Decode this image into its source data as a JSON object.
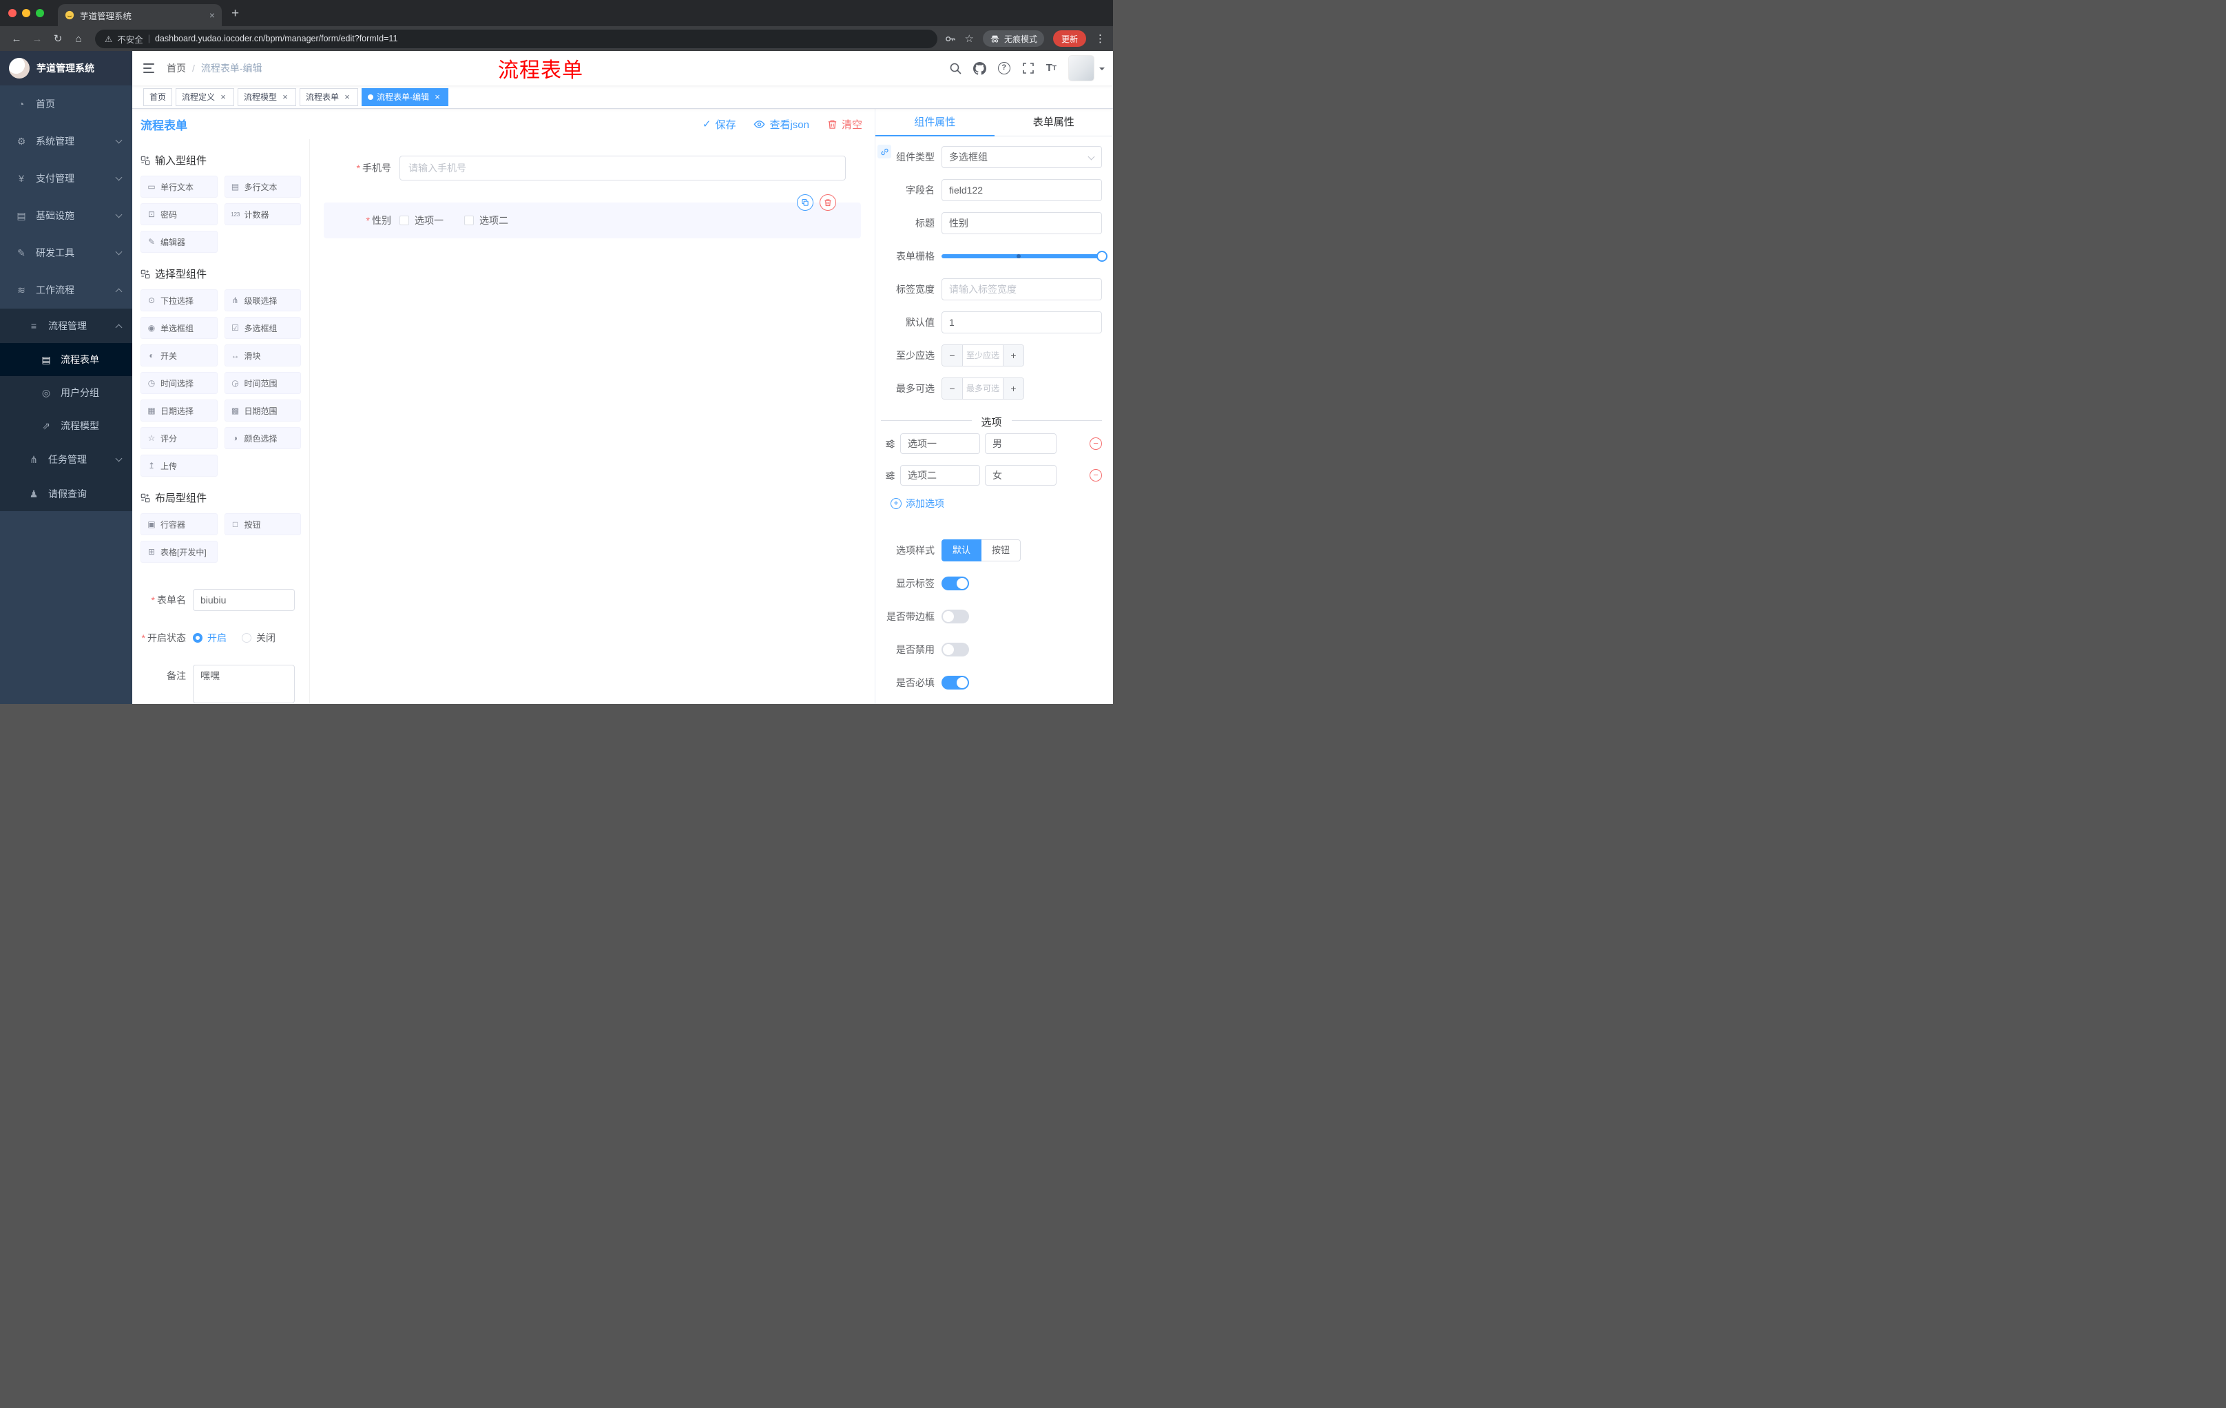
{
  "ui": {
    "close": "×",
    "plus": "+",
    "minus": "−",
    "check": "✓",
    "question": "?",
    "kebab": "⋮",
    "star": "☆",
    "asterisk": "*",
    "t_big": "T",
    "t_small": "T"
  },
  "colors": {
    "accent": "#409eff",
    "danger": "#f56c6c",
    "sidebar": "#304156",
    "active_item": "#001528",
    "overlay_red": "#fe0000"
  },
  "browser": {
    "tab_title": "芋道管理系统",
    "nav_back": "←",
    "nav_forward": "→",
    "nav_reload": "↻",
    "nav_home": "⌂",
    "omnibox_warning": "⚠",
    "omnibox_security": "不安全",
    "omnibox_divider": "|",
    "url": "dashboard.yudao.iocoder.cn/bpm/manager/form/edit?formId=11",
    "incognito_label": "无痕模式",
    "update_label": "更新"
  },
  "sidebar": {
    "logo_title": "芋道管理系统",
    "menu": [
      {
        "glyph": "◔",
        "label": "首页"
      },
      {
        "glyph": "⚙",
        "label": "系统管理"
      },
      {
        "glyph": "¥",
        "label": "支付管理"
      },
      {
        "glyph": "▤",
        "label": "基础设施"
      },
      {
        "glyph": "✎",
        "label": "研发工具"
      },
      {
        "glyph": "≋",
        "label": "工作流程"
      }
    ],
    "process_group": {
      "glyph": "≡",
      "label": "流程管理"
    },
    "process_children": [
      {
        "glyph": "▤",
        "label": "流程表单",
        "active": true
      },
      {
        "glyph": "◎",
        "label": "用户分组",
        "active": false
      },
      {
        "glyph": "⇗",
        "label": "流程模型",
        "active": false
      }
    ],
    "task_item": {
      "glyph": "⋔",
      "label": "任务管理"
    },
    "leave_item": {
      "glyph": "♟",
      "label": "请假查询"
    }
  },
  "header": {
    "breadcrumb_home": "首页",
    "breadcrumb_sep": "/",
    "breadcrumb_current": "流程表单-编辑",
    "overlay_title": "流程表单"
  },
  "tags": [
    {
      "label": "首页",
      "closable": false,
      "active": false
    },
    {
      "label": "流程定义",
      "closable": true,
      "active": false
    },
    {
      "label": "流程模型",
      "closable": true,
      "active": false
    },
    {
      "label": "流程表单",
      "closable": true,
      "active": false
    },
    {
      "label": "流程表单-编辑",
      "closable": true,
      "active": true
    }
  ],
  "designer": {
    "panel_title": "流程表单",
    "save_label": "保存",
    "view_json_label": "查看json",
    "clear_label": "清空",
    "palette_groups": [
      {
        "title": "输入型组件",
        "items": [
          {
            "glyph": "▭",
            "label": "单行文本"
          },
          {
            "glyph": "▤",
            "label": "多行文本"
          },
          {
            "glyph": "⊡",
            "label": "密码"
          },
          {
            "glyph": "123",
            "label": "计数器"
          },
          {
            "glyph": "✎",
            "label": "编辑器"
          }
        ]
      },
      {
        "title": "选择型组件",
        "items": [
          {
            "glyph": "⊙",
            "label": "下拉选择"
          },
          {
            "glyph": "⋔",
            "label": "级联选择"
          },
          {
            "glyph": "◉",
            "label": "单选框组"
          },
          {
            "glyph": "☑",
            "label": "多选框组"
          },
          {
            "glyph": "◐",
            "label": "开关"
          },
          {
            "glyph": "↔",
            "label": "滑块"
          },
          {
            "glyph": "◷",
            "label": "时间选择"
          },
          {
            "glyph": "◶",
            "label": "时间范围"
          },
          {
            "glyph": "▦",
            "label": "日期选择"
          },
          {
            "glyph": "▩",
            "label": "日期范围"
          },
          {
            "glyph": "☆",
            "label": "评分"
          },
          {
            "glyph": "◑",
            "label": "颜色选择"
          },
          {
            "glyph": "↥",
            "label": "上传"
          }
        ]
      },
      {
        "title": "布局型组件",
        "items": [
          {
            "glyph": "▣",
            "label": "行容器"
          },
          {
            "glyph": "□",
            "label": "按钮"
          },
          {
            "glyph": "⊞",
            "label": "表格[开发中]"
          }
        ]
      }
    ],
    "meta": {
      "form_name_label": "表单名",
      "form_name_value": "biubiu",
      "status_label": "开启状态",
      "status_on": "开启",
      "status_off": "关闭",
      "status_selected": "开启",
      "remark_label": "备注",
      "remark_value": "嘿嘿"
    },
    "canvas": {
      "phone_label": "手机号",
      "phone_placeholder": "请输入手机号",
      "gender_label": "性别",
      "gender_options": [
        {
          "label": "选项一"
        },
        {
          "label": "选项二"
        }
      ]
    }
  },
  "props": {
    "tab_component": "组件属性",
    "tab_form": "表单属性",
    "active_tab": "组件属性",
    "component_type_label": "组件类型",
    "component_type_value": "多选框组",
    "field_name_label": "字段名",
    "field_name_value": "field122",
    "title_label": "标题",
    "title_value": "性别",
    "grid_label": "表单栅格",
    "label_width_label": "标签宽度",
    "label_width_placeholder": "请输入标签宽度",
    "default_label": "默认值",
    "default_value": "1",
    "min_label": "至少应选",
    "min_placeholder": "至少应选",
    "max_label": "最多可选",
    "max_placeholder": "最多可选",
    "options_title": "选项",
    "options": [
      {
        "label": "选项一",
        "value": "男"
      },
      {
        "label": "选项二",
        "value": "女"
      }
    ],
    "add_option_label": "添加选项",
    "style_label": "选项样式",
    "style_default": "默认",
    "style_button": "按钮",
    "style_selected": "默认",
    "switches": [
      {
        "label": "显示标签",
        "on": true
      },
      {
        "label": "是否带边框",
        "on": false
      },
      {
        "label": "是否禁用",
        "on": false
      },
      {
        "label": "是否必填",
        "on": true
      }
    ]
  }
}
